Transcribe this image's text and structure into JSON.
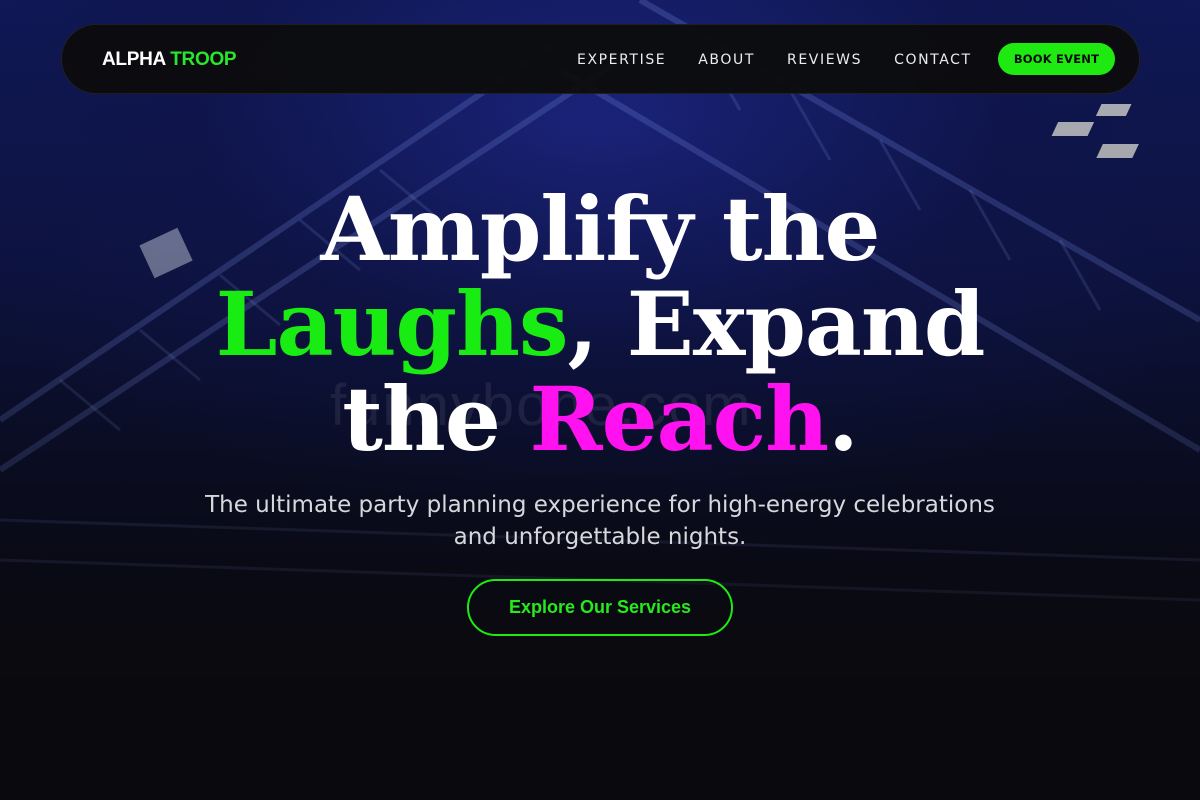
{
  "brand": {
    "logo_part1": "ALPHA",
    "logo_part2": "TROOP",
    "accent_green": "#1eea12",
    "accent_pink": "#ff11f0"
  },
  "nav": {
    "links": [
      "EXPERTISE",
      "ABOUT",
      "REVIEWS",
      "CONTACT"
    ],
    "cta_label": "BOOK EVENT"
  },
  "hero": {
    "headline_line1": "Amplify the",
    "headline_word_green": "Laughs",
    "headline_line2_rest": ", Expand",
    "headline_line3_start": "the ",
    "headline_word_pink": "Reach",
    "headline_end": ".",
    "watermark": "funnybone.com",
    "subtitle": "The ultimate party planning experience for high-energy celebrations and unforgettable nights.",
    "cta_label": "Explore Our Services"
  }
}
